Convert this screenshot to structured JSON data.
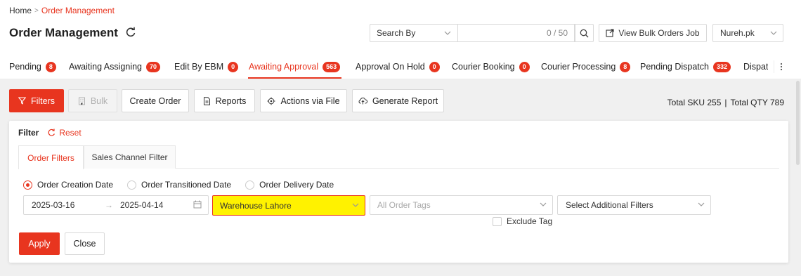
{
  "breadcrumb": {
    "home": "Home",
    "current": "Order Management"
  },
  "page": {
    "title": "Order Management"
  },
  "search": {
    "search_by": "Search By",
    "counter": "0 / 50"
  },
  "header": {
    "bulk_jobs_label": "View Bulk Orders Job",
    "store": "Nureh.pk"
  },
  "tabs": [
    {
      "label": "Pending",
      "count": "8"
    },
    {
      "label": "Awaiting Assigning",
      "count": "70"
    },
    {
      "label": "Edit By EBM",
      "count": "0"
    },
    {
      "label": "Awaiting Approval",
      "count": "563"
    },
    {
      "label": "Approval On Hold",
      "count": "0"
    },
    {
      "label": "Courier Booking",
      "count": "0"
    },
    {
      "label": "Courier Processing",
      "count": "8"
    },
    {
      "label": "Pending Dispatch",
      "count": "332"
    },
    {
      "label": "Dispatc",
      "count": ""
    }
  ],
  "toolbar": {
    "filters": "Filters",
    "bulk": "Bulk",
    "create_order": "Create Order",
    "reports": "Reports",
    "actions_via_file": "Actions via File",
    "generate_report": "Generate Report"
  },
  "totals": {
    "sku": "Total SKU 255",
    "sep": "|",
    "qty": "Total QTY 789"
  },
  "filter_panel": {
    "label": "Filter",
    "reset": "Reset",
    "tabs": [
      "Order Filters",
      "Sales Channel Filter"
    ],
    "date_types": [
      "Order Creation Date",
      "Order Transitioned Date",
      "Order Delivery Date"
    ],
    "date_from": "2025-03-16",
    "date_to": "2025-04-14",
    "warehouse": "Warehouse Lahore",
    "tags_placeholder": "All Order Tags",
    "additional_filters": "Select Additional Filters",
    "exclude_tag": "Exclude Tag",
    "apply": "Apply",
    "close": "Close"
  },
  "colors": {
    "accent": "#e8351f",
    "highlight": "#fff200"
  }
}
